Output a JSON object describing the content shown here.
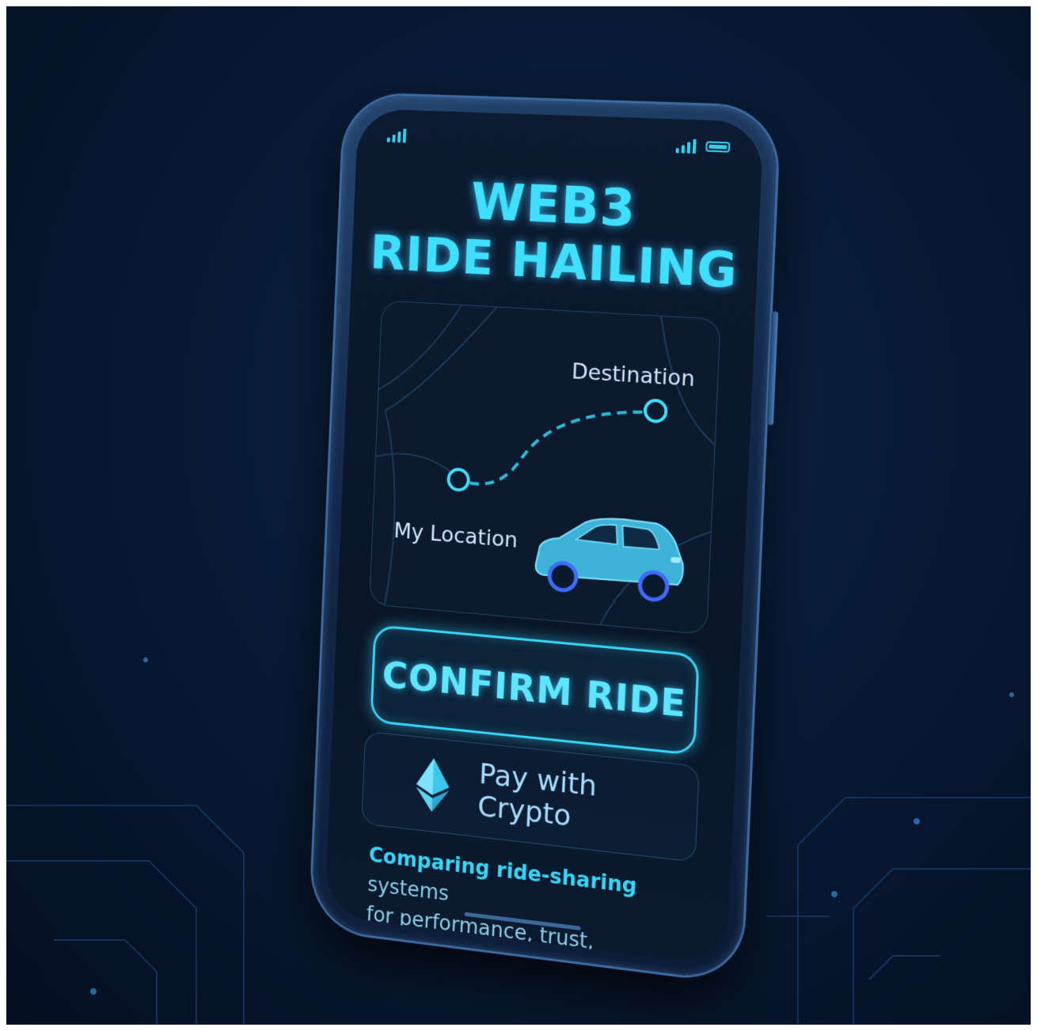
{
  "app": {
    "title_line1": "WEB3",
    "title_line2": "RIDE HAILING"
  },
  "status_bar": {
    "left_icon": "signal-icon",
    "right_icons": [
      "signal-icon",
      "battery-icon"
    ]
  },
  "map": {
    "destination_label": "Destination",
    "origin_label": "My Location",
    "vehicle_icon": "car-icon"
  },
  "actions": {
    "confirm_label": "CONFIRM RIDE",
    "pay_label": "Pay with Crypto",
    "pay_icon": "ethereum-icon"
  },
  "tagline": {
    "strong": "Comparing ride-sharing",
    "rest_line1": " systems",
    "line2": "for performance, trust, scalability"
  },
  "colors": {
    "accent": "#37d4f5",
    "background": "#081a35",
    "screen": "#0a1628"
  }
}
